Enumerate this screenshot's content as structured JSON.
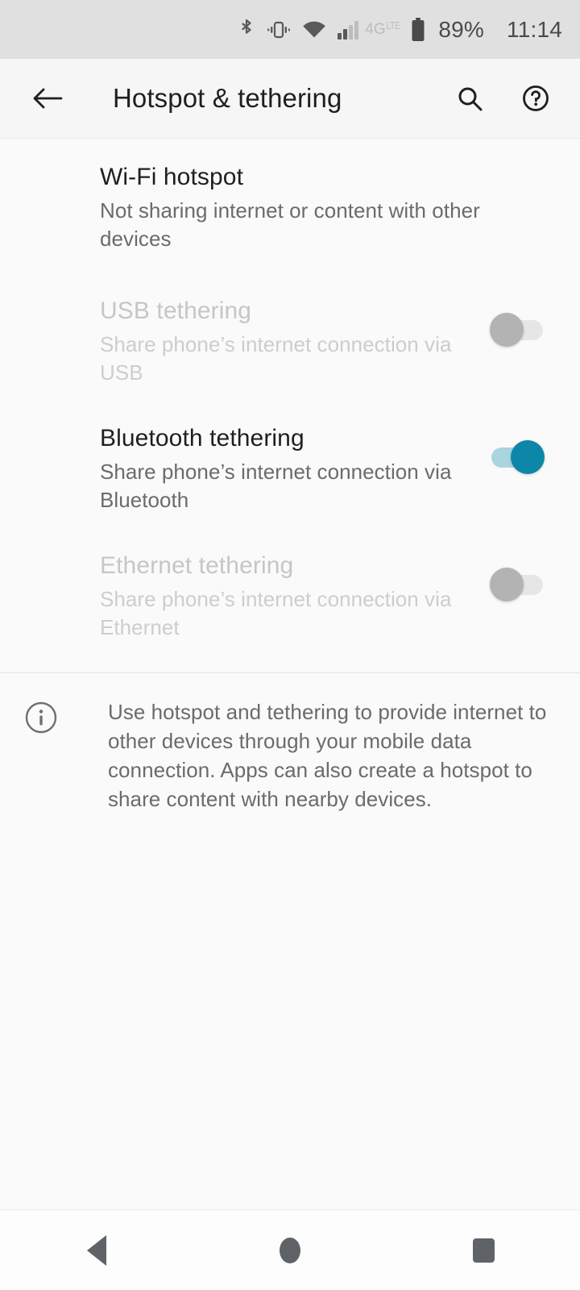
{
  "status_bar": {
    "icons": [
      "bluetooth-icon",
      "vibrate-icon",
      "wifi-icon",
      "cellular-signal-icon"
    ],
    "network_type": "4G",
    "network_type_sub": "LTE",
    "signal_bars_filled": 2,
    "signal_bars_total": 4,
    "battery_percent": "89%",
    "clock": "11:14"
  },
  "app_bar": {
    "back_label": "back-arrow",
    "title": "Hotspot & tethering",
    "search_label": "search-icon",
    "help_label": "help-icon"
  },
  "settings": {
    "items": [
      {
        "title": "Wi-Fi hotspot",
        "summary": "Not sharing internet or content with other devices",
        "has_toggle": false,
        "enabled": true,
        "checked": false
      },
      {
        "title": "USB tethering",
        "summary": "Share phone’s internet connection via USB",
        "has_toggle": true,
        "enabled": false,
        "checked": false
      },
      {
        "title": "Bluetooth tethering",
        "summary": "Share phone’s internet connection via Bluetooth",
        "has_toggle": true,
        "enabled": true,
        "checked": true
      },
      {
        "title": "Ethernet tethering",
        "summary": "Share phone’s internet connection via Ethernet",
        "has_toggle": true,
        "enabled": false,
        "checked": false
      }
    ]
  },
  "footer": {
    "icon": "info-icon",
    "text": "Use hotspot and tethering to provide internet to other devices through your mobile data connection. Apps can also create a hotspot to share content with nearby devices."
  },
  "nav_bar": {
    "back": "back-triangle",
    "home": "home-circle",
    "recents": "recents-square"
  },
  "colors": {
    "accent_on": "#0c87a8",
    "accent_track": "#a9d5e0",
    "toggle_off_thumb": "#b3b3b3",
    "toggle_off_track": "#e6e6e6",
    "status_bar_bg": "#e0e0e0",
    "app_bar_bg": "#f6f6f6",
    "page_bg": "#fafafa",
    "title_text": "#1f1f1f",
    "summary_text": "#6b6b6b",
    "disabled_text": "#c6c6c6",
    "nav_icon": "#5f6368"
  }
}
